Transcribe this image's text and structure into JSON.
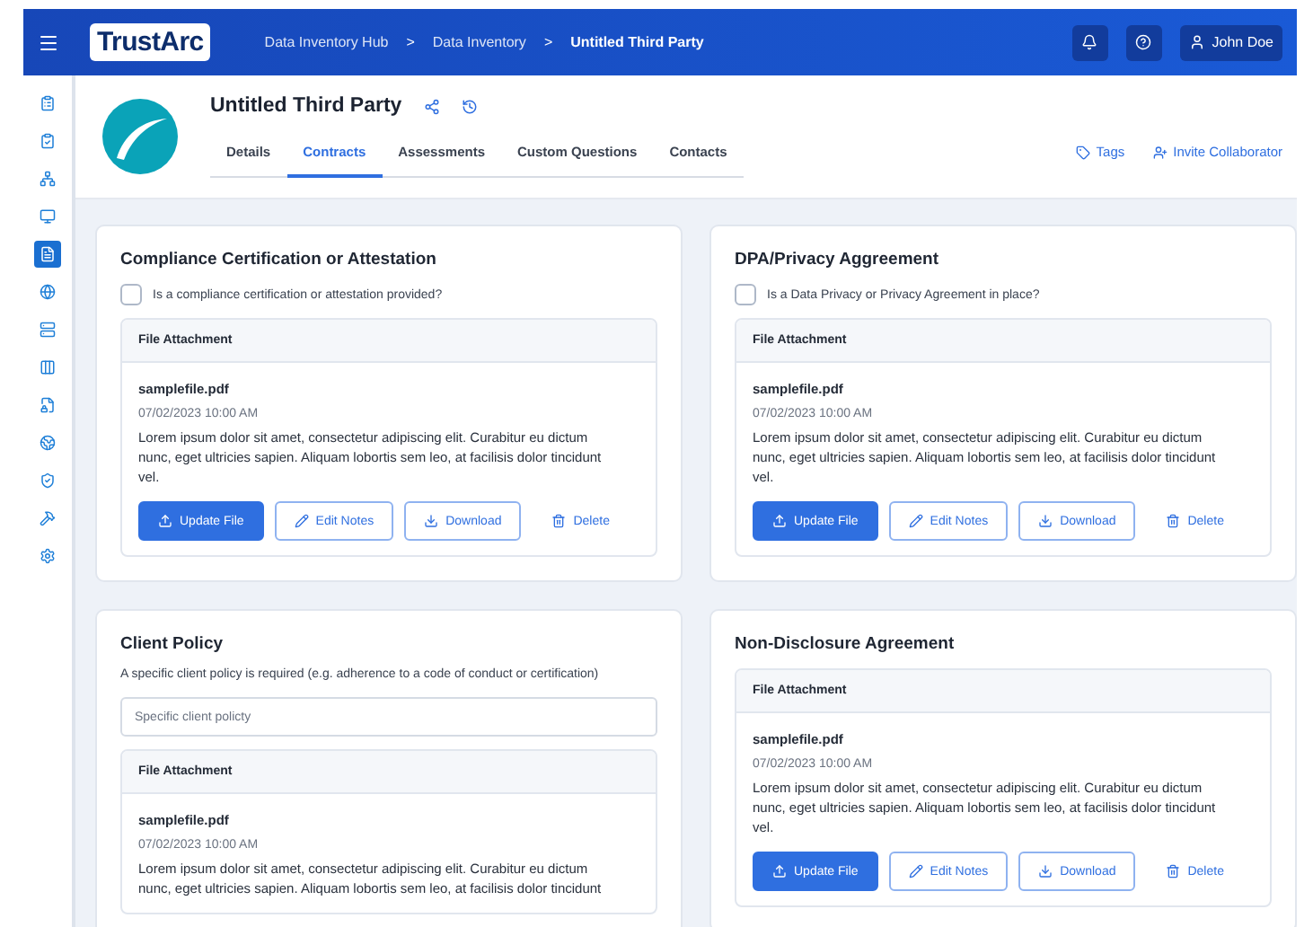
{
  "header": {
    "logo": "TrustArc",
    "breadcrumbs": [
      {
        "label": "Data Inventory Hub",
        "current": false
      },
      {
        "label": "Data Inventory",
        "current": false
      },
      {
        "label": "Untitled Third Party",
        "current": true
      }
    ],
    "separator": ">",
    "user": "John Doe"
  },
  "sidebar": {
    "items": [
      {
        "selected": false
      },
      {
        "selected": false
      },
      {
        "selected": false
      },
      {
        "selected": false
      },
      {
        "selected": true
      },
      {
        "selected": false
      },
      {
        "selected": false
      },
      {
        "selected": false
      },
      {
        "selected": false
      },
      {
        "selected": false
      },
      {
        "selected": false
      },
      {
        "selected": false
      },
      {
        "selected": false
      }
    ]
  },
  "entity": {
    "name": "Untitled Third Party"
  },
  "tabs": [
    {
      "label": "Details",
      "selected": false
    },
    {
      "label": "Contracts",
      "selected": true
    },
    {
      "label": "Assessments",
      "selected": false
    },
    {
      "label": "Custom Questions",
      "selected": false
    },
    {
      "label": "Contacts",
      "selected": false
    }
  ],
  "actions": [
    {
      "label": "Tags",
      "kind": "tag"
    },
    {
      "label": "Invite Collaborator",
      "kind": "invite"
    }
  ],
  "columns": [
    [
      {
        "kind": "checkbox",
        "title": "Compliance Certification or Attestation",
        "question": "Is a compliance certification or attestation provided?",
        "checked": false,
        "attachment": {
          "header": "File Attachment",
          "file": "samplefile.pdf",
          "date": "07/02/2023 10:00 AM",
          "notes": "Lorem ipsum dolor sit amet, consectetur adipiscing elit. Curabitur eu dictum nunc, eget ultricies sapien. Aliquam lobortis sem leo, at facilisis dolor tincidunt vel.",
          "buttons": [
            {
              "label": "Update File",
              "kind": "update"
            },
            {
              "label": "Edit Notes",
              "kind": "edit"
            },
            {
              "label": "Download",
              "kind": "download"
            },
            {
              "label": "Delete",
              "kind": "delete"
            }
          ]
        }
      },
      {
        "kind": "input",
        "title": "Client Policy",
        "description": "A specific client policy is required (e.g. adherence to a code of conduct or certification)",
        "placeholder": "Specific client policty",
        "attachment": {
          "header": "File Attachment",
          "file": "samplefile.pdf",
          "date": "07/02/2023 10:00 AM",
          "notes": "Lorem ipsum dolor sit amet, consectetur adipiscing elit. Curabitur eu dictum nunc, eget ultricies sapien. Aliquam lobortis sem leo, at facilisis dolor tincidunt"
        }
      }
    ],
    [
      {
        "kind": "checkbox",
        "title": "DPA/Privacy Aggreement",
        "question": "Is a Data Privacy or Privacy Agreement in place?",
        "checked": false,
        "attachment": {
          "header": "File Attachment",
          "file": "samplefile.pdf",
          "date": "07/02/2023 10:00 AM",
          "notes": "Lorem ipsum dolor sit amet, consectetur adipiscing elit. Curabitur eu dictum nunc, eget ultricies sapien. Aliquam lobortis sem leo, at facilisis dolor tincidunt vel.",
          "buttons": [
            {
              "label": "Update File",
              "kind": "update"
            },
            {
              "label": "Edit Notes",
              "kind": "edit"
            },
            {
              "label": "Download",
              "kind": "download"
            },
            {
              "label": "Delete",
              "kind": "delete"
            }
          ]
        }
      },
      {
        "kind": "plain",
        "title": "Non-Disclosure Agreement",
        "attachment": {
          "header": "File Attachment",
          "file": "samplefile.pdf",
          "date": "07/02/2023 10:00 AM",
          "notes": "Lorem ipsum dolor sit amet, consectetur adipiscing elit. Curabitur eu dictum nunc, eget ultricies sapien. Aliquam lobortis sem leo, at facilisis dolor tincidunt vel.",
          "buttons": [
            {
              "label": "Update File",
              "kind": "update"
            },
            {
              "label": "Edit Notes",
              "kind": "edit"
            },
            {
              "label": "Download",
              "kind": "download"
            },
            {
              "label": "Delete",
              "kind": "delete"
            }
          ]
        }
      }
    ]
  ]
}
